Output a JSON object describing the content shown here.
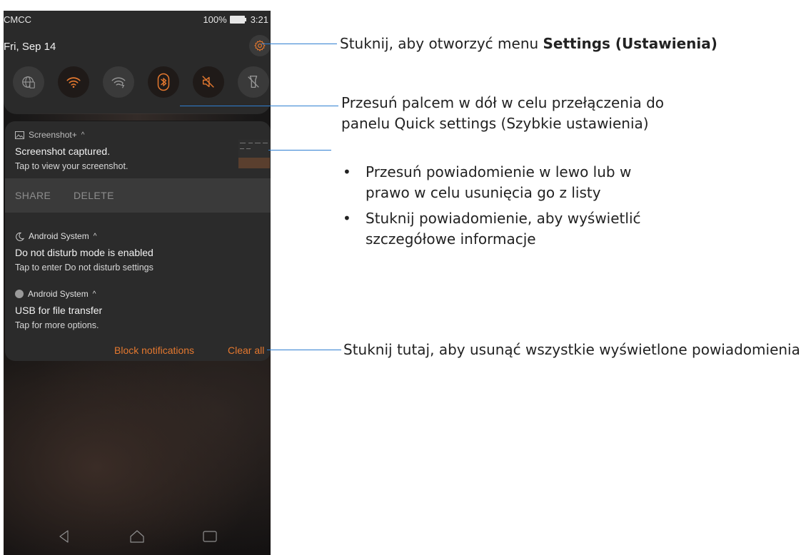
{
  "status_bar": {
    "carrier": "CMCC",
    "battery": "100%",
    "time": "3:21"
  },
  "date": "Fri, Sep 14",
  "quick_tiles": [
    "globe-icon",
    "wifi-icon",
    "wifi-hotspot-icon",
    "bluetooth-icon",
    "mute-icon",
    "flashlight-icon"
  ],
  "notifications": {
    "screenshot": {
      "app": "Screenshot+",
      "title": "Screenshot captured.",
      "body": "Tap to view your screenshot.",
      "actions": [
        "SHARE",
        "DELETE"
      ]
    },
    "dnd": {
      "app": "Android System",
      "title": "Do not disturb mode is enabled",
      "body": "Tap to enter Do not disturb settings"
    },
    "usb": {
      "app": "Android System",
      "title": "USB for file transfer",
      "body": "Tap for more options."
    },
    "block_label": "Block notifications",
    "clear_label": "Clear all"
  },
  "annotations": {
    "settings_pre": "Stuknij, aby otworzyć menu ",
    "settings_bold": "Settings (Ustawienia)",
    "quick_line1": "Przesuń palcem w dół w celu przełączenia do",
    "quick_line2": "panelu Quick settings (Szybkie ustawienia)",
    "bullet_char": "•",
    "swipe_line1": "Przesuń powiadomienie w lewo lub w",
    "swipe_line2": "prawo w celu usunięcia go z listy",
    "tap_line1": "Stuknij powiadomienie, aby wyświetlić",
    "tap_line2": "szczegółowe informacje",
    "clear": "Stuknij tutaj, aby usunąć wszystkie wyświetlone powiadomienia"
  },
  "colors": {
    "accent": "#e4782f",
    "leader": "#2f7fd1",
    "panel": "#2a2a2a"
  }
}
